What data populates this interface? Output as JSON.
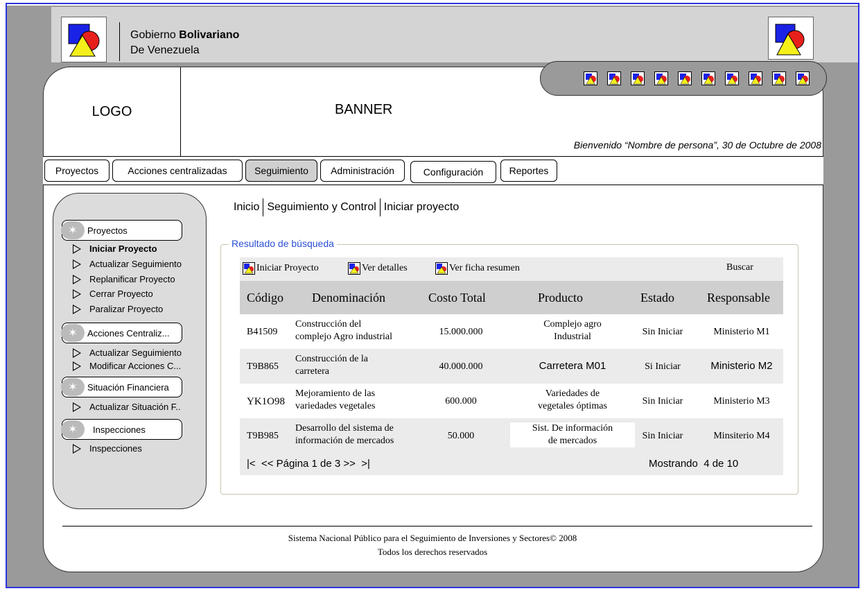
{
  "header": {
    "gov_line1_plain": "Gobierno ",
    "gov_line1_bold": "Bolivariano",
    "gov_line2": "De Venezuela"
  },
  "banner": {
    "logo_label": "LOGO",
    "banner_label": "BANNER",
    "welcome": "Bienvenido “Nombre de persona”, 30 de Octubre de 2008"
  },
  "menu": [
    "Proyectos",
    "Acciones centralizadas",
    "Seguimiento",
    "Administración",
    "Configuración",
    "Reportes"
  ],
  "sidebar": {
    "sections": [
      {
        "title": "Proyectos",
        "items": [
          "Iniciar Proyecto",
          "Actualizar Seguimiento",
          "Replanificar Proyecto",
          "Cerrar Proyecto",
          "Paralizar Proyecto"
        ]
      },
      {
        "title": "Acciones Centraliz...",
        "items": [
          "Actualizar Seguimiento",
          "Modificar Acciones C..."
        ]
      },
      {
        "title": "Situación Financiera",
        "items": [
          "Actualizar Situación F.."
        ]
      },
      {
        "title": "Inspecciones",
        "items": [
          "Inspecciones"
        ]
      }
    ]
  },
  "breadcrumb": [
    "Inicio",
    "Seguimiento y Control",
    "Iniciar proyecto"
  ],
  "results": {
    "legend": "Resultado de búsqueda",
    "toolbar": {
      "iniciar": "Iniciar Proyecto",
      "detalles": "Ver detalles",
      "ficha": "Ver ficha resumen",
      "buscar": "Buscar"
    },
    "columns": [
      "Código",
      "Denominación",
      "Costo Total",
      "Producto",
      "Estado",
      "Responsable"
    ],
    "rows": [
      {
        "codigo": "B41509",
        "den1": "Construcción del",
        "den2": "complejo Agro industrial",
        "costo": "15.000.000",
        "prod1": "Complejo agro",
        "prod2": "Industrial",
        "estado": "Sin Iniciar",
        "resp": "Ministerio M1"
      },
      {
        "codigo": "T9B865",
        "den1": "Construcción de la",
        "den2": "carretera",
        "costo": "40.000.000",
        "prod1": "Carretera M01",
        "prod2": "",
        "estado": "Si Iniciar",
        "resp": "Ministerio M2"
      },
      {
        "codigo": "YK1O98",
        "den1": "Mejoramiento de las",
        "den2": "variedades vegetales",
        "costo": "600.000",
        "prod1": "Variedades de",
        "prod2": "vegetales óptimas",
        "estado": "Sin Iniciar",
        "resp": "Ministerio M3"
      },
      {
        "codigo": "T9B985",
        "den1": "Desarrollo del sistema de",
        "den2": "información de mercados",
        "costo": "50.000",
        "prod1": "Sist. De información",
        "prod2": "de mercados",
        "estado": "Sin Iniciar",
        "resp": "Minsiterio M4"
      }
    ],
    "pager": "|<  << Página 1 de 3 >>  >|",
    "showing": "Mostrando  4 de 10"
  },
  "footer": {
    "line1": "Sistema Nacional Público para el Seguimiento de Inversiones y Sectores© 2008",
    "line2": "Todos los derechos reservados"
  },
  "colors": {
    "frame": "#2a35e0",
    "legend": "#2a4fd6",
    "gray": "#9a9a9a"
  }
}
